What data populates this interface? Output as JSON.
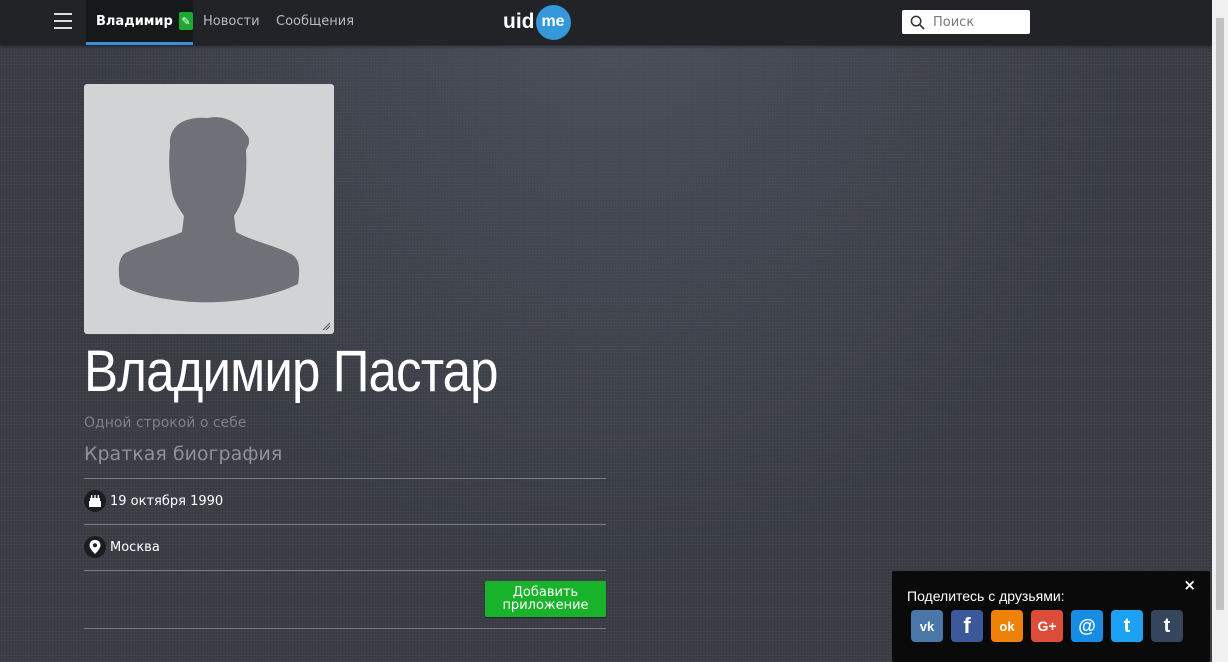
{
  "header": {
    "user_name": "Владимир",
    "nav": [
      "Новости",
      "Сообщения"
    ],
    "logo_left": "uid",
    "logo_right": "me",
    "search_placeholder": "Поиск"
  },
  "profile": {
    "name": "Владимир Пастар",
    "tagline": "Одной строкой о себе",
    "bio": "Краткая биография",
    "birthday": "19 октября 1990",
    "city": "Москва",
    "add_app_line1": "Добавить",
    "add_app_line2": "приложение"
  },
  "share": {
    "title": "Поделитесь с друзьями:",
    "close": "×",
    "networks": [
      {
        "icon": "vk-icon",
        "glyph": "vk",
        "color": "#4a76a8"
      },
      {
        "icon": "facebook-icon",
        "glyph": "f",
        "color": "#3b5998"
      },
      {
        "icon": "odnoklassniki-icon",
        "glyph": "ok",
        "color": "#ee8208"
      },
      {
        "icon": "google-plus-icon",
        "glyph": "G+",
        "color": "#dd4b39"
      },
      {
        "icon": "moimir-icon",
        "glyph": "@",
        "color": "#168de2"
      },
      {
        "icon": "twitter-icon",
        "glyph": "t",
        "color": "#1da1f2"
      },
      {
        "icon": "tumblr-icon",
        "glyph": "t",
        "color": "#35465c"
      }
    ]
  },
  "colors": {
    "accent": "#3a8fd9",
    "green": "#19b22b",
    "topbar": "#222326"
  }
}
